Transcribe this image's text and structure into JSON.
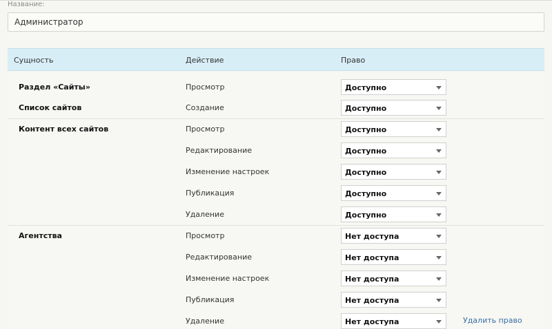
{
  "form": {
    "name_label": "Название:",
    "name_value": "Администратор"
  },
  "table": {
    "headers": {
      "entity": "Сущность",
      "action": "Действие",
      "right": "Право"
    },
    "rows": [
      {
        "entity": "Раздел «Сайты»",
        "action": "Просмотр",
        "right": "Доступно"
      },
      {
        "entity": "Список сайтов",
        "action": "Создание",
        "right": "Доступно"
      },
      {
        "entity": "Контент всех сайтов",
        "action": "Просмотр",
        "right": "Доступно"
      },
      {
        "entity": "",
        "action": "Редактирование",
        "right": "Доступно"
      },
      {
        "entity": "",
        "action": "Изменение настроек",
        "right": "Доступно"
      },
      {
        "entity": "",
        "action": "Публикация",
        "right": "Доступно"
      },
      {
        "entity": "",
        "action": "Удаление",
        "right": "Доступно"
      },
      {
        "entity": "Агентства",
        "action": "Просмотр",
        "right": "Нет доступа"
      },
      {
        "entity": "",
        "action": "Редактирование",
        "right": "Нет доступа"
      },
      {
        "entity": "",
        "action": "Изменение настроек",
        "right": "Нет доступа"
      },
      {
        "entity": "",
        "action": "Публикация",
        "right": "Нет доступа"
      },
      {
        "entity": "",
        "action": "Удаление",
        "right": "Нет доступа"
      }
    ],
    "delete_link": "Удалить право"
  },
  "colors": {
    "header_bg": "#d8eef7",
    "link": "#3a6fa6"
  }
}
